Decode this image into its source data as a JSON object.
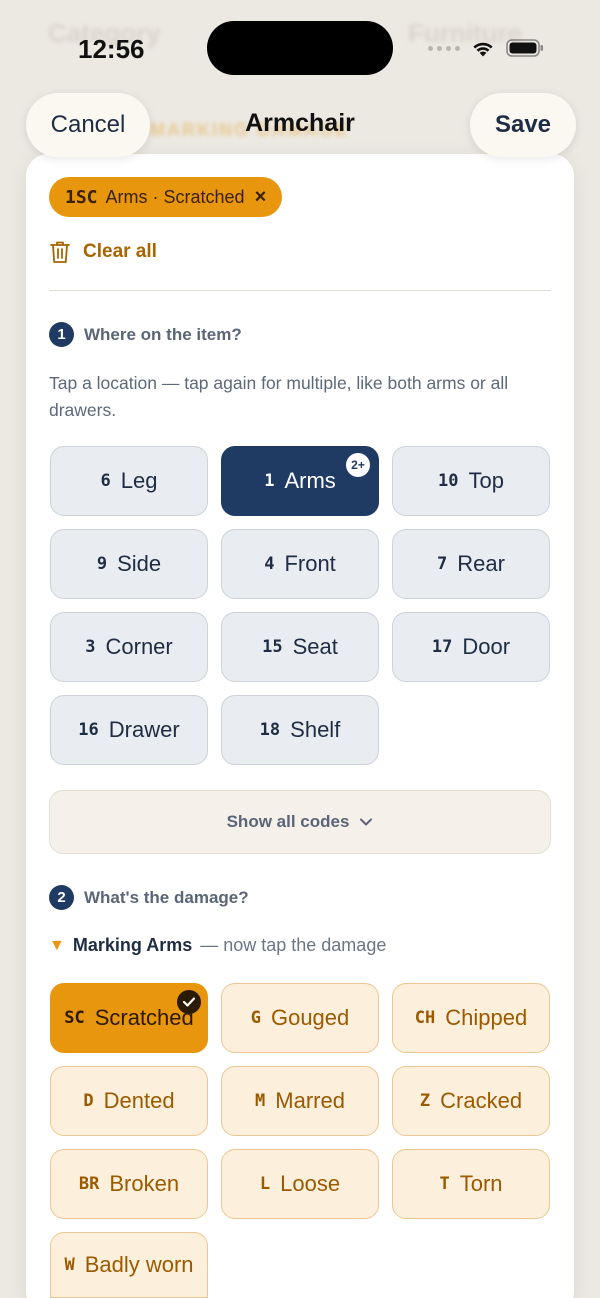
{
  "status_bar": {
    "time": "12:56"
  },
  "background": {
    "left_text": "Category",
    "right_text": "Furniture",
    "orange_text": "MARKING DAMAGE"
  },
  "nav": {
    "cancel_label": "Cancel",
    "title": "Armchair",
    "save_label": "Save"
  },
  "selection_chip": {
    "code": "1SC",
    "label": "Arms · Scratched",
    "close_symbol": "×"
  },
  "clear_all_label": "Clear all",
  "step1": {
    "number": "1",
    "title": "Where on the item?",
    "helper": "Tap a location — tap again for multiple, like both arms or all drawers.",
    "locations": [
      {
        "code": "6",
        "label": "Leg"
      },
      {
        "code": "1",
        "label": "Arms",
        "selected": true,
        "badge": "2+"
      },
      {
        "code": "10",
        "label": "Top"
      },
      {
        "code": "9",
        "label": "Side"
      },
      {
        "code": "4",
        "label": "Front"
      },
      {
        "code": "7",
        "label": "Rear"
      },
      {
        "code": "3",
        "label": "Corner"
      },
      {
        "code": "15",
        "label": "Seat"
      },
      {
        "code": "17",
        "label": "Door"
      },
      {
        "code": "16",
        "label": "Drawer"
      },
      {
        "code": "18",
        "label": "Shelf"
      }
    ],
    "show_all_label": "Show all codes"
  },
  "step2": {
    "number": "2",
    "title": "What's the damage?",
    "marking_prefix": "Marking Arms",
    "marking_suffix": "— now tap the damage",
    "damages": [
      {
        "code": "SC",
        "label": "Scratched",
        "selected": true
      },
      {
        "code": "G",
        "label": "Gouged"
      },
      {
        "code": "CH",
        "label": "Chipped"
      },
      {
        "code": "D",
        "label": "Dented"
      },
      {
        "code": "M",
        "label": "Marred"
      },
      {
        "code": "Z",
        "label": "Cracked"
      },
      {
        "code": "BR",
        "label": "Broken"
      },
      {
        "code": "L",
        "label": "Loose"
      },
      {
        "code": "T",
        "label": "Torn"
      },
      {
        "code": "W",
        "label": "Badly worn"
      }
    ]
  },
  "colors": {
    "navy": "#1f3a63",
    "orange": "#e9960f",
    "cream": "#fcefdc"
  }
}
